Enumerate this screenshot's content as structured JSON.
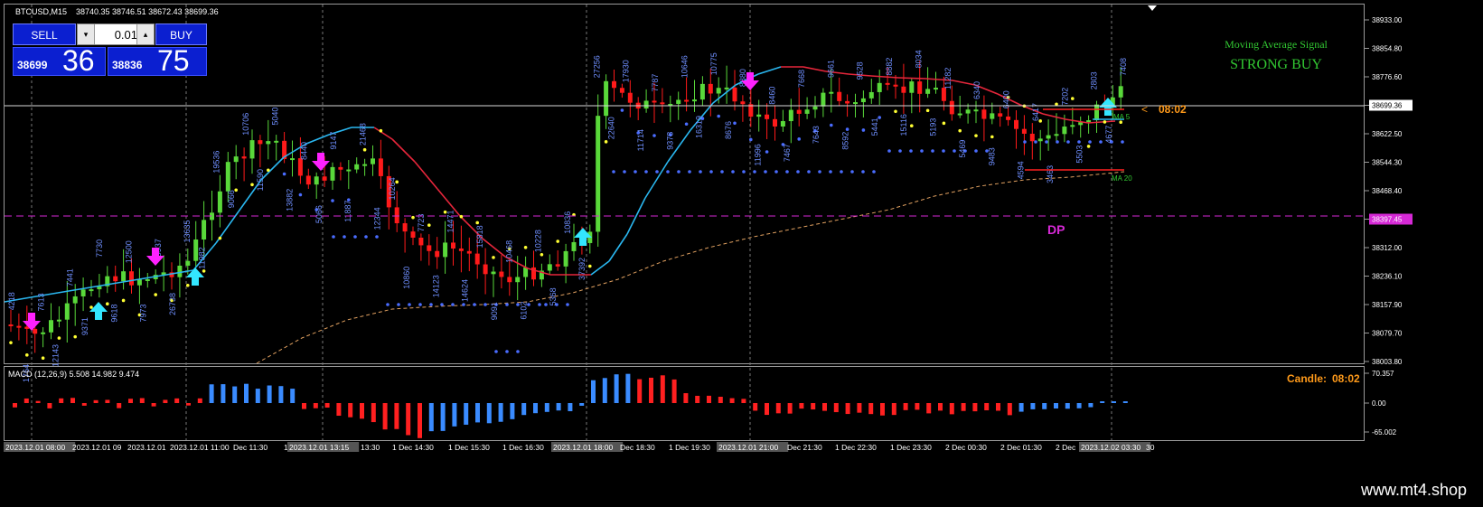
{
  "header": {
    "symbol": "BTCUSD,M15",
    "ohlc": "38740.35 38746.51 38672.43 38699.36"
  },
  "trade_panel": {
    "sell_label": "SELL",
    "buy_label": "BUY",
    "lot": "0.01",
    "sell_small": "38699",
    "sell_big": "36",
    "buy_small": "38836",
    "buy_big": "75"
  },
  "signal": {
    "title": "Moving Average Signal",
    "value": "STRONG BUY"
  },
  "labels": {
    "dp": "DP",
    "ma5": "MA 5",
    "ma20": "MA 20",
    "countdown": "08:02",
    "countdown_arrow": "<"
  },
  "price_axis": {
    "ticks": [
      "38933.00",
      "38854.80",
      "38776.60",
      "38699.36",
      "38622.50",
      "38544.30",
      "38468.40",
      "38397.45",
      "38312.00",
      "38236.10",
      "38157.90",
      "38079.70",
      "38003.80"
    ],
    "current": "38699.36",
    "dp_level": "38397.45"
  },
  "macd": {
    "label": "MACD (12,26,9) 5.508 14.982 9.474",
    "candle_label": "Candle:",
    "candle_time": "08:02",
    "axis": [
      "70.357",
      "0.00",
      "-65.002"
    ]
  },
  "time_axis": [
    {
      "text": "2023.12.01 08:00",
      "hl": true
    },
    {
      "text": "2023.12.01 09",
      "hl": false
    },
    {
      "text": "2023.12.01",
      "hl": false
    },
    {
      "text": "2023.12.01 11:00",
      "hl": false
    },
    {
      "text": "Dec 11:30",
      "hl": false
    },
    {
      "text": "1",
      "hl": false
    },
    {
      "text": "2023.12.01 13:15",
      "hl": true
    },
    {
      "text": "13:30",
      "hl": false
    },
    {
      "text": "1 Dec 14:30",
      "hl": false
    },
    {
      "text": "1 Dec 15:30",
      "hl": false
    },
    {
      "text": "1 Dec 16:30",
      "hl": false
    },
    {
      "text": "2023.12.01 18:00",
      "hl": true
    },
    {
      "text": "Dec 18:30",
      "hl": false
    },
    {
      "text": "1 Dec 19:30",
      "hl": false
    },
    {
      "text": "2023.12.01 21:00",
      "hl": true
    },
    {
      "text": "Dec 21:30",
      "hl": false
    },
    {
      "text": "1 Dec 22:30",
      "hl": false
    },
    {
      "text": "1 Dec 23:30",
      "hl": false
    },
    {
      "text": "2 Dec 00:30",
      "hl": false
    },
    {
      "text": "2 Dec 01:30",
      "hl": false
    },
    {
      "text": "2 Dec",
      "hl": false
    },
    {
      "text": "2023.12.02 03:30",
      "hl": true
    },
    {
      "text": "30",
      "hl": false
    }
  ],
  "volume_labels": [
    "4218",
    "1764",
    "7613",
    "12143",
    "7441",
    "9371",
    "7730",
    "9618",
    "12500",
    "7973",
    "5937",
    "26738",
    "13635",
    "11982",
    "19536",
    "9066",
    "10706",
    "11590",
    "5040",
    "13882",
    "8440",
    "5066",
    "9147",
    "11887",
    "21468",
    "12344",
    "10264",
    "10860",
    "7723",
    "14123",
    "14471",
    "14624",
    "15818",
    "9091",
    "10468",
    "6102",
    "10228",
    "5368",
    "10836",
    "37392",
    "27256",
    "22640",
    "17930",
    "11714",
    "7787",
    "9378",
    "10646",
    "16319",
    "10775",
    "8676",
    "8880",
    "11996",
    "8460",
    "7467",
    "7668",
    "7643",
    "9661",
    "8592",
    "9528",
    "5441",
    "8882",
    "15116",
    "8034",
    "5193",
    "11282",
    "5469",
    "6340",
    "9483",
    "6400",
    "4594",
    "6417",
    "3463",
    "7202",
    "5503",
    "2803",
    "4677",
    "7408"
  ],
  "colors": {
    "background": "#000000",
    "bull_candle": "#59d83a",
    "bear_candle": "#ff1a1a",
    "ma5": "#2ab7f0",
    "ma5_down": "#e6263b",
    "ma20": "#e0a060",
    "dp_line": "#d629d6",
    "signal_text": "#32c832",
    "macd_pos": "#3a8bff",
    "macd_neg": "#ff2020",
    "sar": "#ffff33",
    "orange": "#ff9a1a",
    "brand_bar": "#1b1b1b"
  },
  "brand": "www.mt4.shop"
}
